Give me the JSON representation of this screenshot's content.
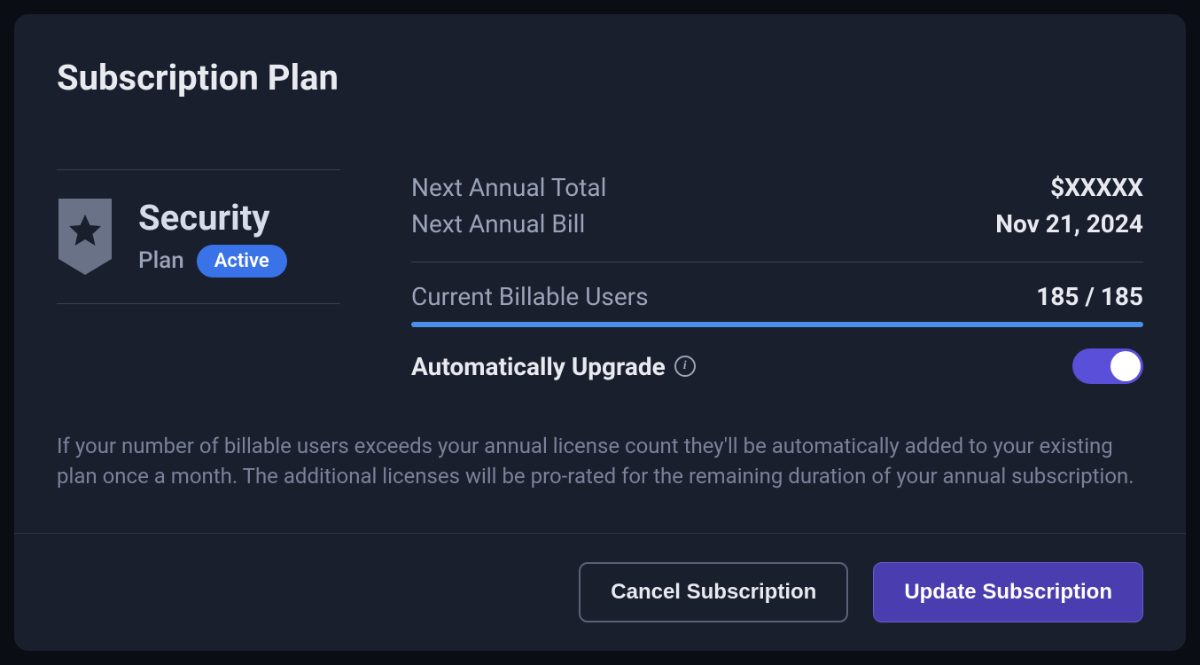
{
  "header": {
    "title": "Subscription Plan"
  },
  "plan": {
    "name": "Security",
    "sub_label": "Plan",
    "status_badge": "Active",
    "icon": "shield-star-icon"
  },
  "billing": {
    "next_total_label": "Next Annual Total",
    "next_total_value": "$XXXXX",
    "next_bill_label": "Next Annual Bill",
    "next_bill_value": "Nov 21, 2024",
    "users_label": "Current Billable Users",
    "users_value": "185 / 185",
    "users_current": 185,
    "users_max": 185,
    "auto_upgrade_label": "Automatically Upgrade",
    "auto_upgrade_on": true
  },
  "note": "If your number of billable users exceeds your annual license count they'll be automatically added to your existing plan once a month. The additional licenses will be pro-rated for the remaining duration of your annual subscription.",
  "footer": {
    "cancel_label": "Cancel Subscription",
    "update_label": "Update Subscription"
  }
}
